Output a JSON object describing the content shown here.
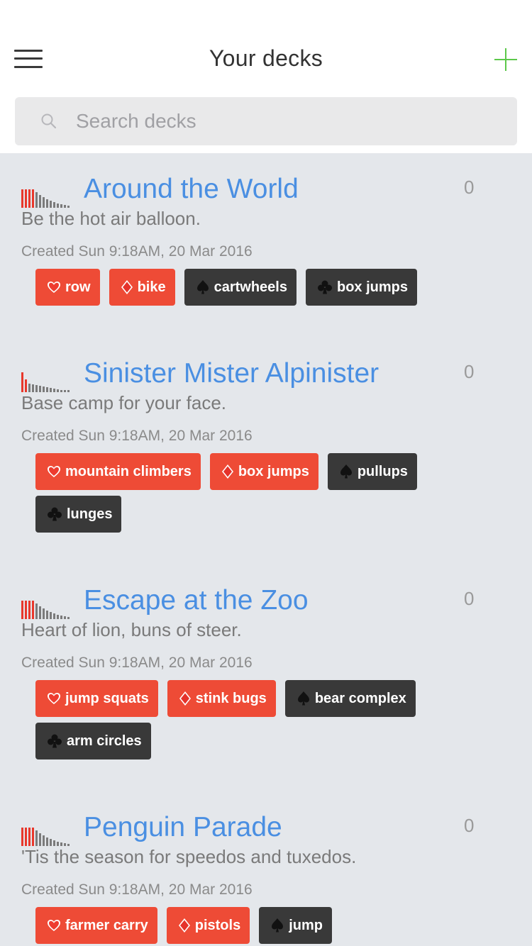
{
  "header": {
    "title": "Your decks",
    "menu_icon": "hamburger-menu-icon",
    "add_icon": "plus-icon",
    "accent": "#5cc84a"
  },
  "search": {
    "placeholder": "Search decks",
    "value": ""
  },
  "colors": {
    "title": "#4a8fe2",
    "tag_red": "#ee4b36",
    "tag_dark": "#393939",
    "background": "#e4e7eb"
  },
  "decks": [
    {
      "title": "Around the World",
      "description": "Be the hot air balloon.",
      "created": "Created Sun 9:18AM, 20 Mar 2016",
      "count": "0",
      "tags": [
        {
          "suit": "heart",
          "label": "row",
          "color": "red"
        },
        {
          "suit": "diamond",
          "label": "bike",
          "color": "red"
        },
        {
          "suit": "spade",
          "label": "cartwheels",
          "color": "dark"
        },
        {
          "suit": "club",
          "label": "box jumps",
          "color": "dark"
        }
      ]
    },
    {
      "title": "Sinister Mister Alpinister",
      "description": "Base camp for your face.",
      "created": "Created Sun 9:18AM, 20 Mar 2016",
      "count": "0",
      "tags": [
        {
          "suit": "heart",
          "label": "mountain climbers",
          "color": "red"
        },
        {
          "suit": "diamond",
          "label": "box jumps",
          "color": "red"
        },
        {
          "suit": "spade",
          "label": "pullups",
          "color": "dark"
        },
        {
          "suit": "club",
          "label": "lunges",
          "color": "dark"
        }
      ]
    },
    {
      "title": "Escape at the Zoo",
      "description": "Heart of lion, buns of steer.",
      "created": "Created Sun 9:18AM, 20 Mar 2016",
      "count": "0",
      "tags": [
        {
          "suit": "heart",
          "label": "jump squats",
          "color": "red"
        },
        {
          "suit": "diamond",
          "label": "stink bugs",
          "color": "red"
        },
        {
          "suit": "spade",
          "label": "bear complex",
          "color": "dark"
        },
        {
          "suit": "club",
          "label": "arm circles",
          "color": "dark"
        }
      ]
    },
    {
      "title": "Penguin Parade",
      "description": "'Tis the season for speedos and tuxedos.",
      "created": "Created Sun 9:18AM, 20 Mar 2016",
      "count": "0",
      "tags": [
        {
          "suit": "heart",
          "label": "farmer carry",
          "color": "red"
        },
        {
          "suit": "diamond",
          "label": "pistols",
          "color": "red"
        },
        {
          "suit": "spade",
          "label": "jump",
          "color": "dark"
        }
      ]
    }
  ]
}
